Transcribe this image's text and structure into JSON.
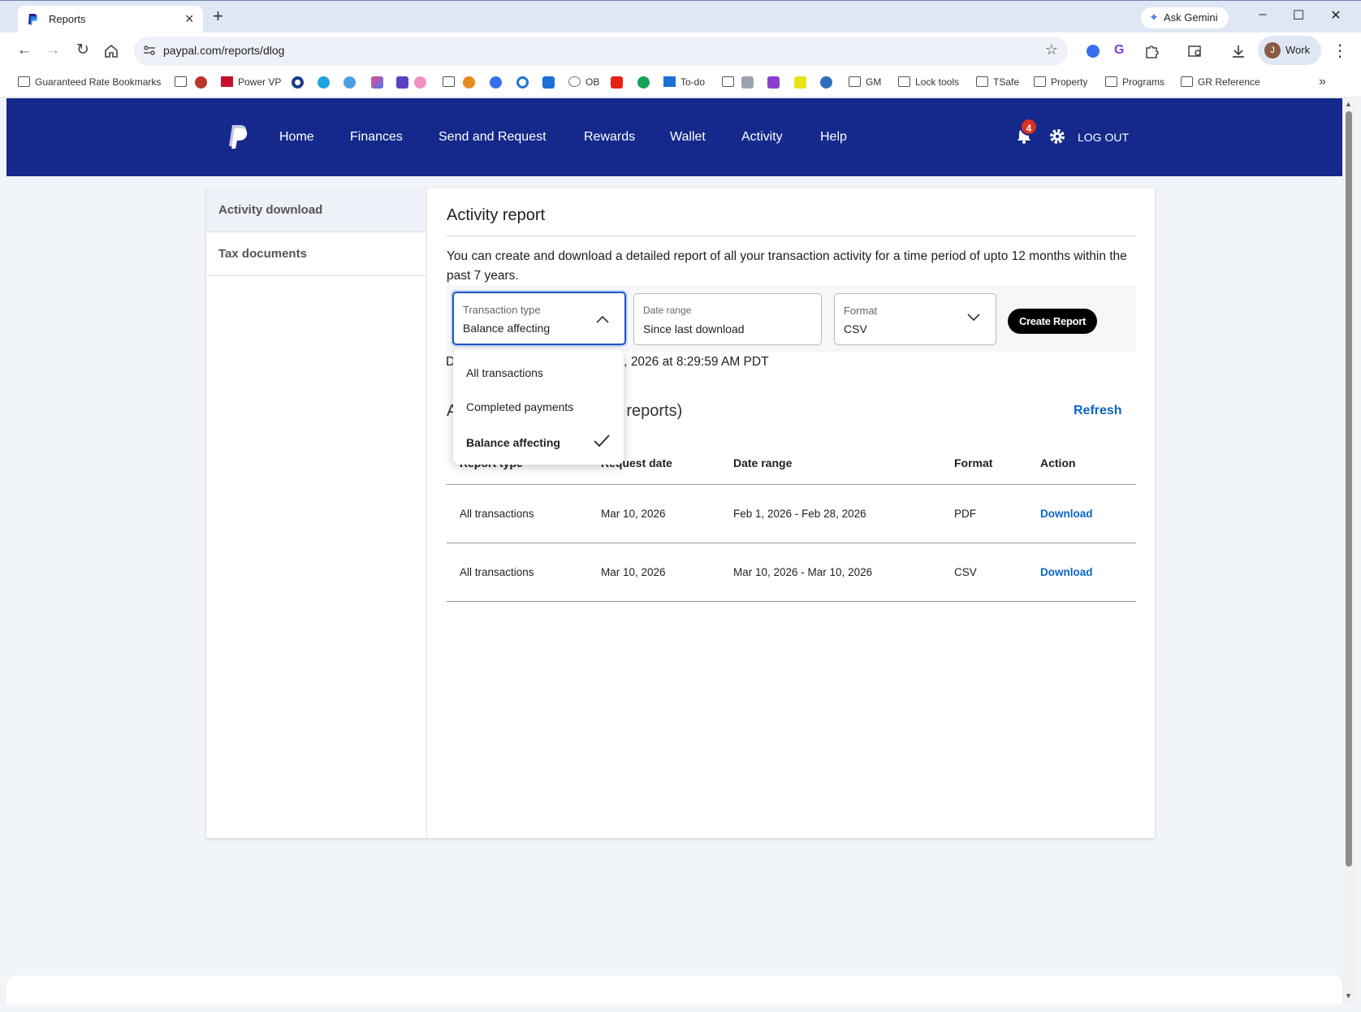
{
  "browser": {
    "tab_title": "Reports",
    "url": "paypal.com/reports/dlog",
    "gemini_label": "Ask Gemini",
    "profile_initial": "J",
    "profile_label": "Work",
    "bookmarks": [
      {
        "label": "Guaranteed Rate Bookmarks",
        "icon": "bookmark-folder-icon"
      },
      {
        "label": "Power VP",
        "icon": "power-vp-icon"
      },
      {
        "label": "OB",
        "icon": "ob-icon"
      },
      {
        "label": "To-do",
        "icon": "box-icon"
      },
      {
        "label": "GM",
        "icon": "folder-icon"
      },
      {
        "label": "Lock tools",
        "icon": "folder-icon"
      },
      {
        "label": "TSafe",
        "icon": "folder-icon"
      },
      {
        "label": "Property",
        "icon": "folder-icon"
      },
      {
        "label": "Programs",
        "icon": "folder-icon"
      },
      {
        "label": "GR Reference",
        "icon": "folder-icon"
      }
    ]
  },
  "header": {
    "nav": [
      "Home",
      "Finances",
      "Send and Request",
      "Rewards",
      "Wallet",
      "Activity",
      "Help"
    ],
    "notification_count": "4",
    "logout_label": "LOG OUT",
    "brand_color": "#14298b"
  },
  "sidebar": {
    "items": [
      {
        "label": "Activity download",
        "active": true
      },
      {
        "label": "Tax documents",
        "active": false
      }
    ]
  },
  "report": {
    "title": "Activity report",
    "description": "You can create and download a detailed report of all your transaction activity for a time period of upto 12 months within the past 7 years.",
    "transaction_type": {
      "label": "Transaction type",
      "value": "Balance affecting"
    },
    "date_range": {
      "label": "Date range",
      "value": "Since last download"
    },
    "format": {
      "label": "Format",
      "value": "CSV"
    },
    "create_label": "Create Report",
    "download_note_start": "D",
    "download_note_end": ", 2026 at 8:29:59 AM PDT",
    "available_start": "A",
    "available_end": "reports)",
    "refresh_label": "Refresh"
  },
  "dropdown": {
    "options": [
      "All transactions",
      "Completed payments",
      "Balance affecting"
    ],
    "selected": "Balance affecting"
  },
  "table": {
    "columns": [
      "Report type",
      "Request date",
      "Date range",
      "Format",
      "Action"
    ],
    "rows": [
      {
        "type": "All transactions",
        "request_date": "Mar 10, 2026",
        "date_range": "Feb 1, 2026 - Feb 28, 2026",
        "format": "PDF",
        "action": "Download"
      },
      {
        "type": "All transactions",
        "request_date": "Mar 10, 2026",
        "date_range": "Mar 10, 2026 - Mar 10, 2026",
        "format": "CSV",
        "action": "Download"
      }
    ]
  }
}
